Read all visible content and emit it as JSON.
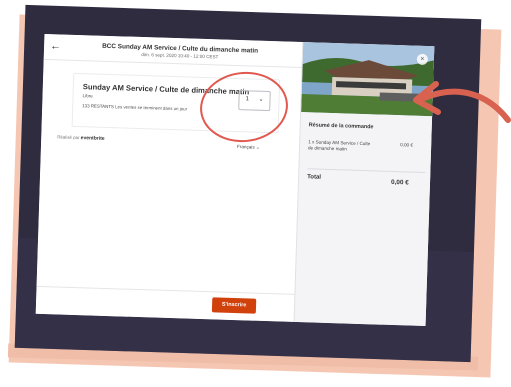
{
  "header": {
    "title": "BCC Sunday AM Service / Culte du dimanche matin",
    "date": "dim. 6 sept. 2020 10:40 - 12:00 CEST"
  },
  "ticket": {
    "name": "Sunday AM Service / Culte de dimanche matin",
    "price_label": "Libre",
    "remaining": "133 RESTANTS",
    "sales_note": "Les ventes se terminent dans un jour",
    "quantity": "1",
    "chevron": "chevron-down-icon"
  },
  "powered_by": {
    "prefix": "Réalisé par",
    "brand": "eventbrite"
  },
  "language": {
    "label": "Français"
  },
  "cta": {
    "label": "S'inscrire"
  },
  "summary": {
    "title": "Résumé de la commande",
    "line_item": "1 x Sunday AM Service / Culte de dimanche matin",
    "line_amount": "0,00 €",
    "total_label": "Total",
    "total_amount": "0,00 €"
  },
  "colors": {
    "frame": "#2f2c40",
    "accent": "#d1410c",
    "annotation": "#e1584f",
    "backdrop": "#f5c7b3"
  }
}
